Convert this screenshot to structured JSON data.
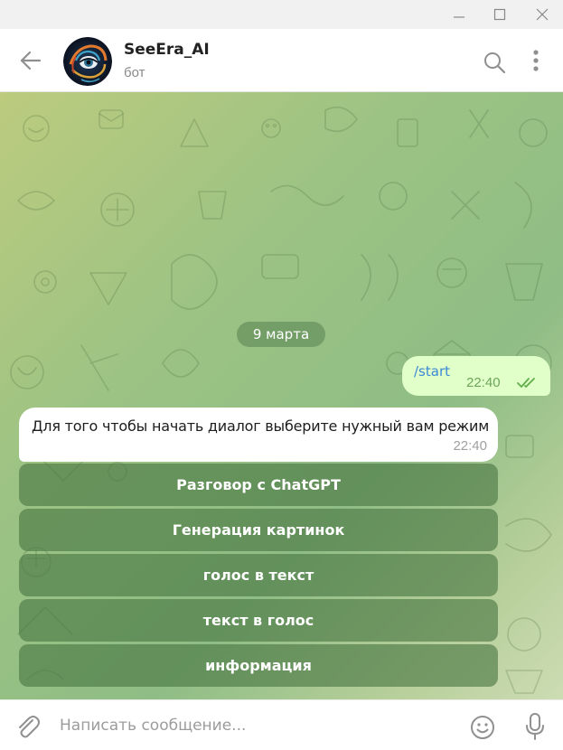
{
  "window": {
    "controls": [
      "minimize-icon",
      "maximize-icon",
      "close-icon"
    ]
  },
  "header": {
    "chat_name": "SeeEra_AI",
    "status": "бот",
    "icons": [
      "back-arrow-icon",
      "search-icon",
      "more-vertical-icon"
    ]
  },
  "chat": {
    "date_label": "9 марта",
    "outgoing": {
      "text": "/start",
      "time": "22:40",
      "status_icon": "double-check-icon"
    },
    "incoming": {
      "text": "Для того чтобы начать диалог выберите нужный вам режим",
      "time": "22:40"
    },
    "keyboard_buttons": [
      "Разговор с ChatGPT",
      "Генерация картинок",
      "голос в текст",
      "текст в голос",
      "информация"
    ]
  },
  "composer": {
    "placeholder": "Написать сообщение...",
    "icons": [
      "paperclip-icon",
      "emoji-icon",
      "microphone-icon"
    ]
  },
  "colors": {
    "outgoing_bubble": "#e1ffc8",
    "link_text": "#3a8ad6",
    "keyboard_button": "#487642"
  }
}
